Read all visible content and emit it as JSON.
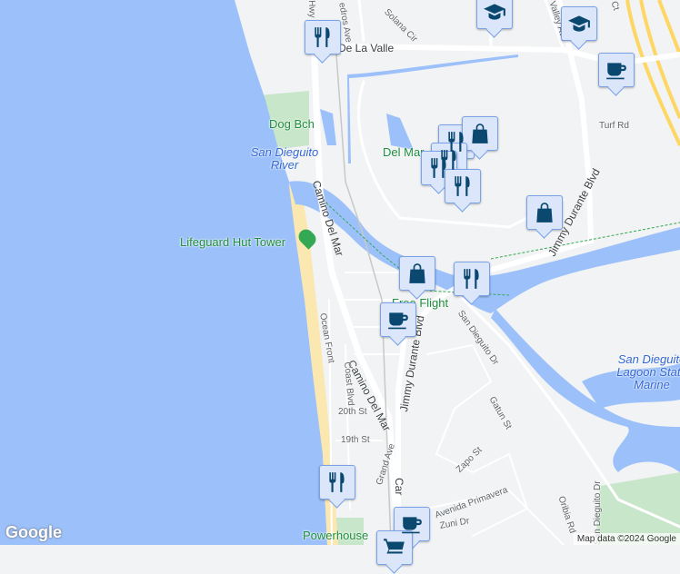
{
  "map": {
    "roads": {
      "camino_del_mar_1": "Camino Del Mar",
      "camino_del_mar_2": "Camino Del Mar",
      "camino_del_mar_3": "Car",
      "via_de_la_valle": "De La Valle",
      "hwy": "Hwy",
      "cedros": "edros Ave",
      "solana_cir": "Solana Cir",
      "valley_ave": "Valley Ave",
      "ct": "Ct",
      "turf_rd": "Turf Rd",
      "jimmy_durante_1": "Jimmy Durante Blvd",
      "jimmy_durante_2": "Jimmy Durante Blvd",
      "san_dieguito_dr_1": "San Dieguito Dr",
      "san_dieguito_dr_2": "San Dieguito Dr",
      "ocean_front": "Ocean Front",
      "coast_blvd": "Coast Blvd",
      "th20": "20th St",
      "th19": "19th St",
      "grand_ave": "Grand Ave",
      "gatun_st": "Gatun St",
      "zapo_st": "Zapo St",
      "avenida_primavera": "Avenida Primavera",
      "zuni_dr": "Zuni Dr",
      "oribia_rd": "Oribia Rd"
    },
    "places": {
      "dog_beach": "Dog Bch",
      "san_dieguito_river": "San Dieguito River",
      "lifeguard": "Lifeguard Hut Tower",
      "del_mar": "Del Mar",
      "free_flight": "Free Flight",
      "lagoon": "San Dieguito Lagoon State Marine",
      "powerhouse": "Powerhouse"
    },
    "colors": {
      "water": "#9cc0f9",
      "land": "#f1f3f4",
      "park": "#c8e6c9",
      "sand": "#fbe7b0",
      "freeway": "#fdd663",
      "marker_icon": "#0b4870"
    },
    "markers": [
      "restaurant",
      "school",
      "school",
      "cafe",
      "restaurant",
      "shopping",
      "restaurant",
      "restaurant",
      "restaurant",
      "shopping",
      "shopping",
      "restaurant",
      "cafe",
      "restaurant",
      "cafe",
      "grocery"
    ]
  },
  "footer": {
    "logo": "Google",
    "attribution": "Map data ©2024 Google"
  }
}
